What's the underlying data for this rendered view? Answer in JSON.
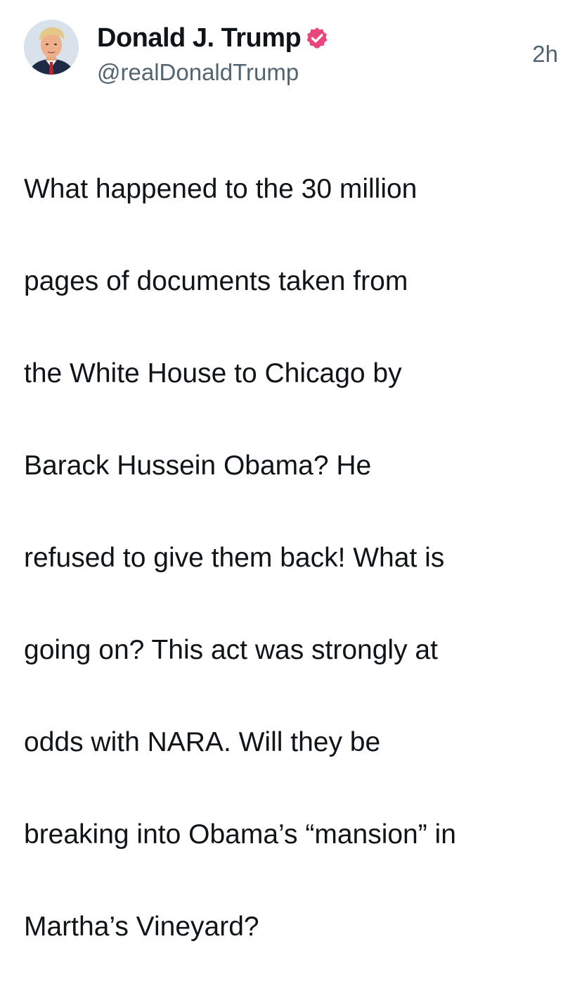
{
  "post": {
    "author": {
      "display_name": "Donald J. Trump",
      "handle": "@realDonaldTrump",
      "verified": true,
      "verified_color": "#e8467d",
      "avatar_icon": "profile-photo"
    },
    "timestamp": "2h",
    "body_lines": [
      "What happened to the 30 million",
      "pages of documents taken from",
      "the White House to Chicago by",
      "Barack Hussein Obama? He",
      "refused to give them back! What is",
      "going on? This act was strongly at",
      "odds with NARA. Will they be",
      "breaking into Obama’s “mansion” in",
      "Martha’s Vineyard?"
    ]
  },
  "colors": {
    "text_primary": "#0f1419",
    "text_secondary": "#536471",
    "background": "#ffffff"
  }
}
